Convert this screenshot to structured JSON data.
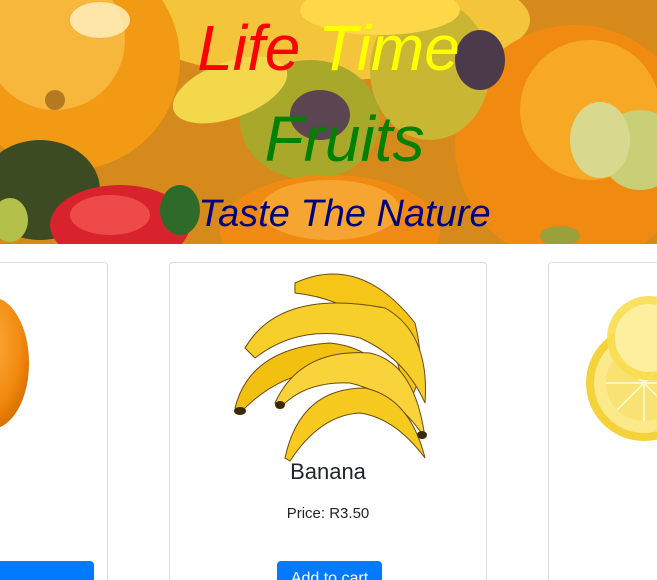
{
  "hero": {
    "title_word1": "Life",
    "title_word2": "Time",
    "title_line2": "Fruits",
    "tagline": "Taste The Nature",
    "colors": {
      "word1": "#ff0000",
      "word2": "#ffff00",
      "line2": "#008000",
      "tagline": "#000080"
    }
  },
  "products": [
    {
      "name": "",
      "price": "",
      "button": "",
      "image": "orange-image"
    },
    {
      "name": "Banana",
      "price": "Price: R3.50",
      "button": "Add to cart",
      "image": "banana-image"
    },
    {
      "name": "",
      "price": "",
      "button": "",
      "image": "lemon-image"
    }
  ],
  "accent": "#007bff"
}
